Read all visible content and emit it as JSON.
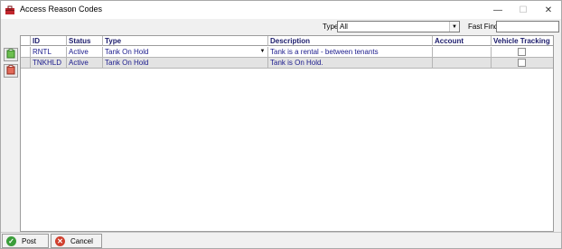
{
  "window": {
    "title": "Access Reason Codes",
    "controls": {
      "minimize": "—",
      "maximize": "☐",
      "close": "✕"
    }
  },
  "filter": {
    "type_label": "Type",
    "type_value": "All",
    "fastfind_label": "Fast Find",
    "fastfind_value": ""
  },
  "grid": {
    "columns": [
      "ID",
      "Status",
      "Type",
      "Description",
      "Account",
      "Vehicle Tracking"
    ],
    "rows": [
      {
        "id": "RNTL",
        "status": "Active",
        "type": "Tank On Hold",
        "description": "Tank is a rental - between tenants",
        "account": "",
        "vehicle_tracking": false
      },
      {
        "id": "TNKHLD",
        "status": "Active",
        "type": "Tank On Hold",
        "description": "Tank is On Hold.",
        "account": "",
        "vehicle_tracking": false
      }
    ]
  },
  "footer": {
    "post_label": "Post",
    "cancel_label": "Cancel"
  },
  "colors": {
    "header_text": "#1b1b6b",
    "cell_text": "#1a1a8c",
    "selected_row": "#e3e3e3",
    "post_icon": "#3a9d3a",
    "cancel_icon": "#d0402f"
  },
  "icons": {
    "app": "red-toolbox-icon",
    "side_add": "add-record-icon",
    "side_delete": "delete-record-icon",
    "post": "checkmark-icon",
    "cancel": "cancel-x-icon",
    "dropdown": "chevron-down-icon"
  }
}
